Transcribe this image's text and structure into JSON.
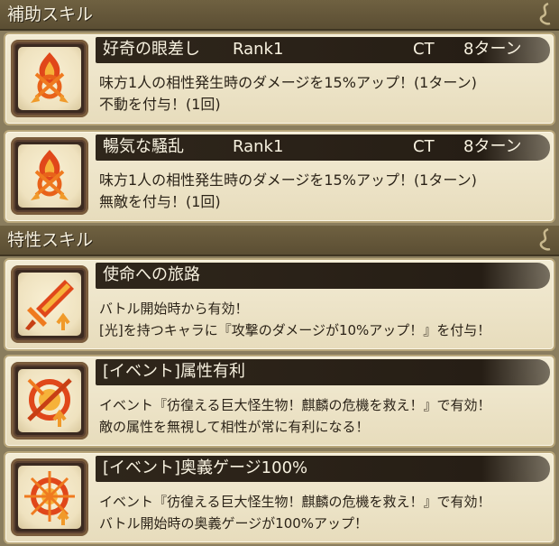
{
  "sections": [
    {
      "label": "補助スキル"
    },
    {
      "label": "特性スキル"
    }
  ],
  "support_skills": [
    {
      "title": "好奇の眼差し",
      "rank": "Rank1",
      "ct_label": "CT",
      "ct_value": "8ターン",
      "lines": [
        "味方1人の相性発生時のダメージを15%アップ！(1ターン)",
        "不動を付与！(1回)"
      ],
      "icon": "flame-arrows-icon"
    },
    {
      "title": "暢気な騒乱",
      "rank": "Rank1",
      "ct_label": "CT",
      "ct_value": "8ターン",
      "lines": [
        "味方1人の相性発生時のダメージを15%アップ！(1ターン)",
        "無敵を付与！(1回)"
      ],
      "icon": "flame-arrows-icon"
    }
  ],
  "trait_skills": [
    {
      "title": "使命への旅路",
      "lines": [
        "バトル開始時から有効！",
        "[光]を持つキャラに『攻撃のダメージが10%アップ！』を付与！"
      ],
      "icon": "sword-up-icon"
    },
    {
      "title": "[イベント]属性有利",
      "lines": [
        "イベント『彷徨える巨大怪生物！麒麟の危機を救え！』で有効！",
        "敵の属性を無視して相性が常に有利になる！"
      ],
      "icon": "crossed-circle-icon"
    },
    {
      "title": "[イベント]奥義ゲージ100%",
      "lines": [
        "イベント『彷徨える巨大怪生物！麒麟の危機を救え！』で有効！",
        "バトル開始時の奥義ゲージが100%アップ！"
      ],
      "icon": "burst-emblem-icon"
    }
  ],
  "colors": {
    "header_bg": "#5b4e33",
    "card_bg": "#ede3c6",
    "title_bar": "#2a2118",
    "icon_orange": "#e8621a"
  }
}
